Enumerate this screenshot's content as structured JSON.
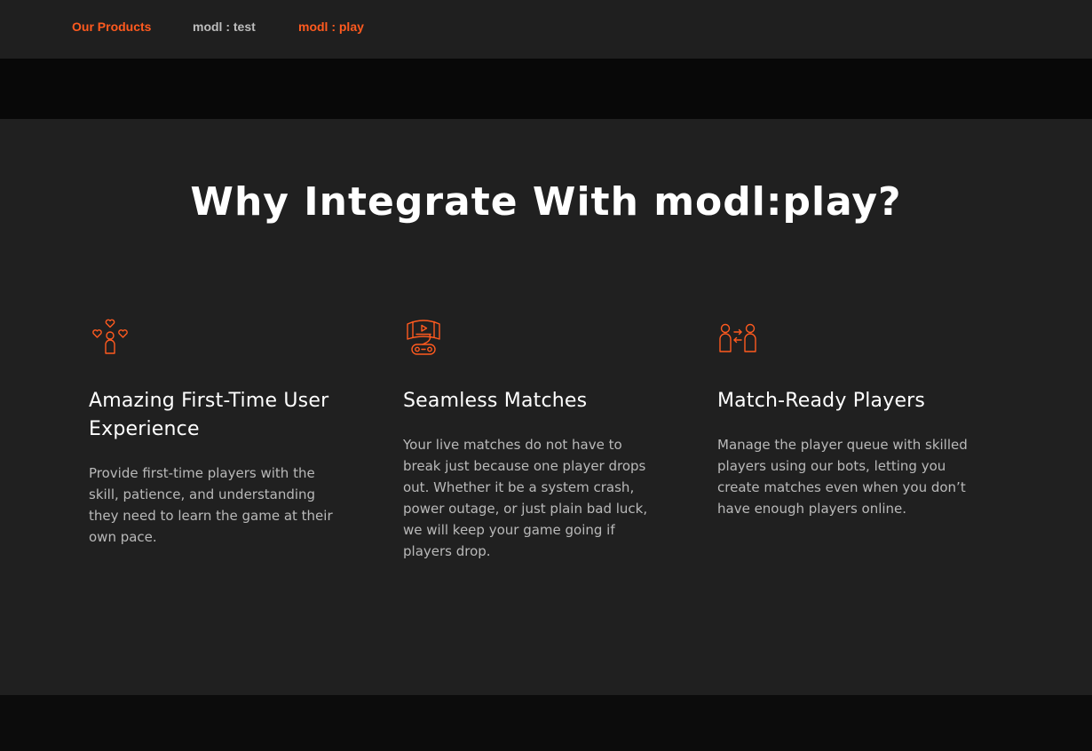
{
  "nav": {
    "items": [
      {
        "label": "Our Products",
        "color": "#ff5a1f"
      },
      {
        "label": "modl : test",
        "color": "#bdbdbd"
      },
      {
        "label": "modl : play",
        "color": "#ff5a1f"
      }
    ]
  },
  "section": {
    "heading": "Why Integrate With modl:play?",
    "features": [
      {
        "icon": "hearts-player-icon",
        "title": "Amazing First-Time User Experience",
        "description": "Provide first-time players with the skill, patience, and understanding they need to learn the game at their own pace."
      },
      {
        "icon": "screen-controller-icon",
        "title": "Seamless Matches",
        "description": "Your live matches do not have to break just because one player drops out. Whether it be a system crash, power outage, or just plain bad luck, we will keep your game going if players drop."
      },
      {
        "icon": "player-swap-icon",
        "title": "Match-Ready Players",
        "description": "Manage the player queue with skilled players using our bots, letting you create matches even when you don’t have enough players online."
      }
    ]
  },
  "colors": {
    "accent": "#ff5a1f",
    "nav_bg": "#1f1f1f",
    "section_bg": "#202020",
    "dark_band": "#080808"
  }
}
